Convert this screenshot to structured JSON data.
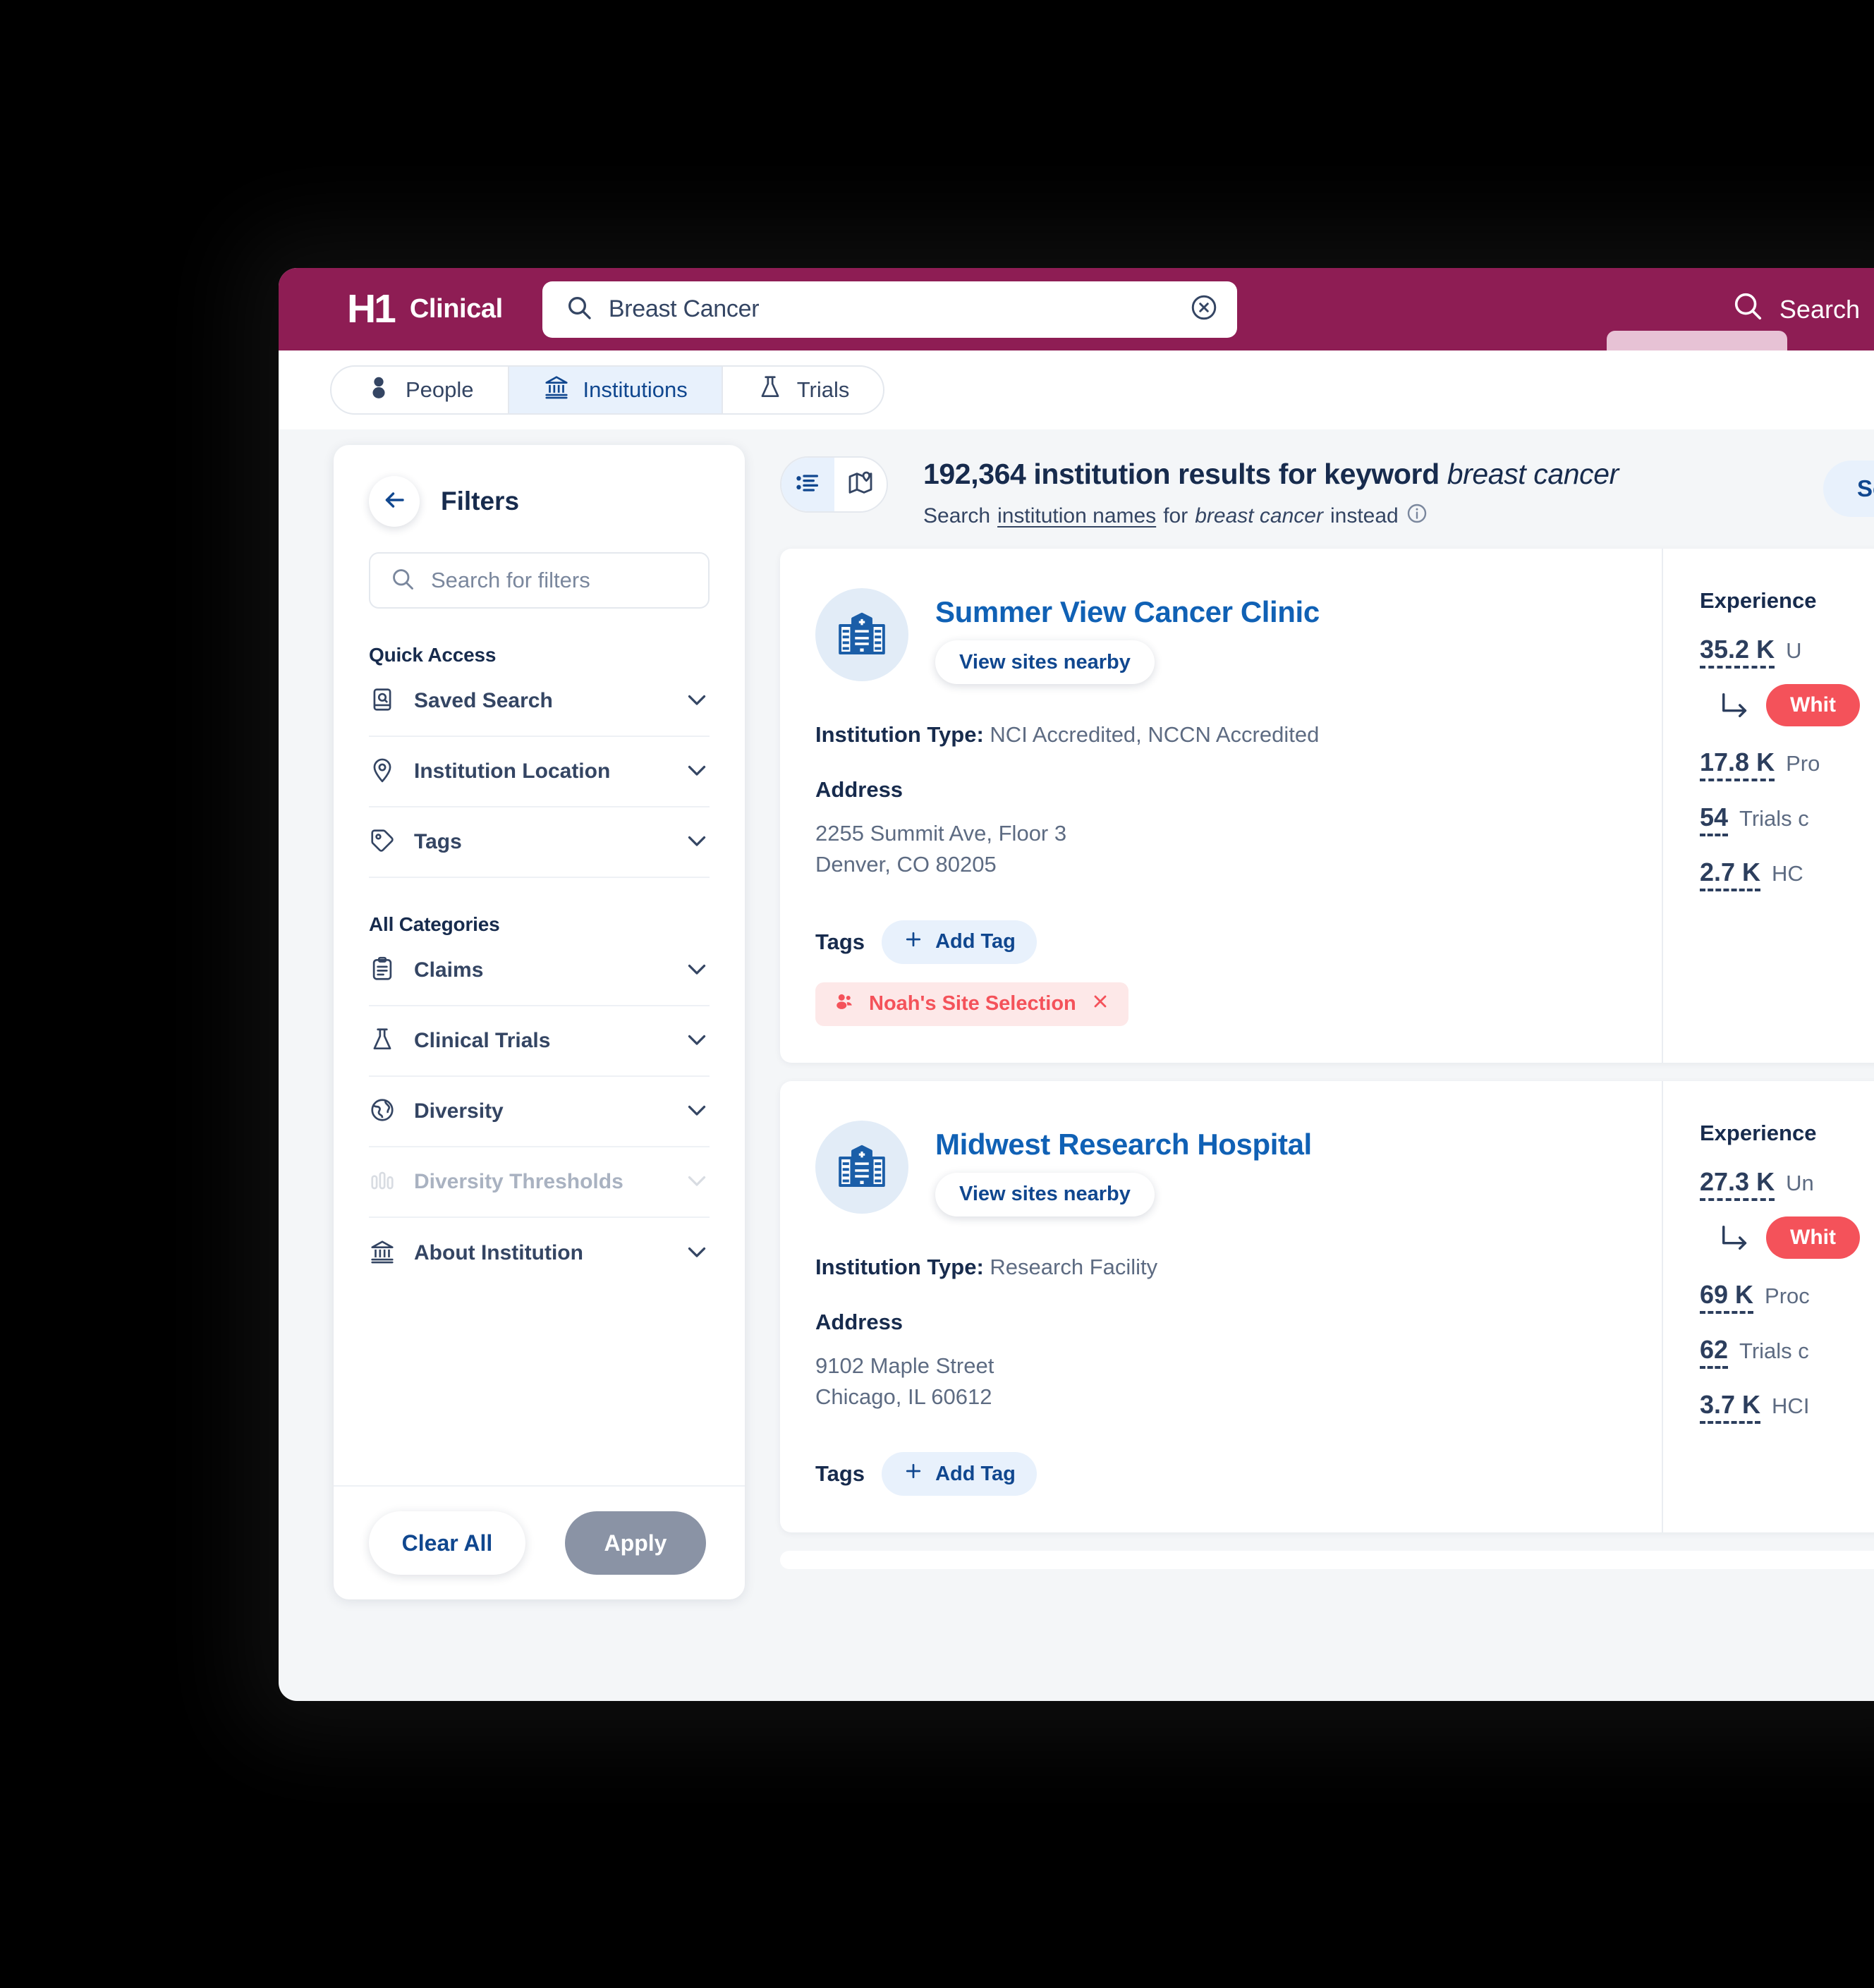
{
  "header": {
    "logo_mark": "H1",
    "logo_word": "Clinical",
    "search_value": "Breast Cancer",
    "search_icon": "search-icon",
    "clear_icon": "clear-circle-icon",
    "nav_search_label": "Search",
    "nav_search_icon": "search-icon",
    "nav_list_icon": "list-menu-icon",
    "brand_color": "#8e1d54"
  },
  "entity_tabs": [
    {
      "label": "People",
      "icon": "person-icon",
      "active": false
    },
    {
      "label": "Institutions",
      "icon": "institution-icon",
      "active": true
    },
    {
      "label": "Trials",
      "icon": "flask-icon",
      "active": false
    }
  ],
  "filters": {
    "title": "Filters",
    "back_icon": "arrow-left-icon",
    "search_placeholder": "Search for filters",
    "search_icon": "search-icon",
    "quick_access_label": "Quick Access",
    "quick_access": [
      {
        "label": "Saved Search",
        "icon": "saved-search-icon",
        "disabled": false
      },
      {
        "label": "Institution Location",
        "icon": "map-pin-icon",
        "disabled": false
      },
      {
        "label": "Tags",
        "icon": "tag-icon",
        "disabled": false
      }
    ],
    "all_categories_label": "All Categories",
    "all_categories": [
      {
        "label": "Claims",
        "icon": "clipboard-icon",
        "disabled": false
      },
      {
        "label": "Clinical Trials",
        "icon": "flask-icon",
        "disabled": false
      },
      {
        "label": "Diversity",
        "icon": "globe-icon",
        "disabled": false
      },
      {
        "label": "Diversity Thresholds",
        "icon": "bar-chart-icon",
        "disabled": true
      },
      {
        "label": "About Institution",
        "icon": "institution-icon",
        "disabled": false
      }
    ],
    "chevron_icon": "chevron-down-icon",
    "clear_all_label": "Clear All",
    "apply_label": "Apply"
  },
  "results_header": {
    "list_view_icon": "list-view-icon",
    "map_view_icon": "map-view-icon",
    "count": "192,364",
    "title_prefix": "192,364 institution results for keyword",
    "keyword": "breast cancer",
    "sub_prefix": "Search",
    "sub_link": "institution names",
    "sub_mid": "for",
    "sub_keyword": "breast cancer",
    "sub_suffix": "instead",
    "info_icon": "info-icon",
    "sort_label": "Sort"
  },
  "cards": [
    {
      "avatar_icon": "hospital-building-icon",
      "name": "Summer View Cancer Clinic",
      "nearby_label": "View sites nearby",
      "type_label": "Institution Type:",
      "type_value": "NCI Accredited, NCCN Accredited",
      "address_label": "Address",
      "address_line1": "2255 Summit Ave, Floor 3",
      "address_line2": "Denver, CO 80205",
      "tags_label": "Tags",
      "add_tag_label": "Add Tag",
      "add_tag_icon": "plus-icon",
      "tags": [
        {
          "label": "Noah's Site Selection",
          "icon": "people-icon",
          "remove_icon": "close-icon",
          "color": "#f4525a"
        }
      ],
      "experience_title": "Experience",
      "stats": [
        {
          "num": "35.2 K",
          "label": "U"
        },
        {
          "num": "17.8 K",
          "label": "Pro"
        },
        {
          "num": "54",
          "label": "Trials c"
        },
        {
          "num": "2.7 K",
          "label": "HC"
        }
      ],
      "sub_stat": {
        "elbow_icon": "elbow-arrow-icon",
        "pill": "Whit"
      }
    },
    {
      "avatar_icon": "hospital-building-icon",
      "name": "Midwest Research Hospital",
      "nearby_label": "View sites nearby",
      "type_label": "Institution Type:",
      "type_value": "Research Facility",
      "address_label": "Address",
      "address_line1": "9102 Maple Street",
      "address_line2": "Chicago, IL 60612",
      "tags_label": "Tags",
      "add_tag_label": "Add Tag",
      "add_tag_icon": "plus-icon",
      "tags": [],
      "experience_title": "Experience",
      "stats": [
        {
          "num": "27.3 K",
          "label": "Un"
        },
        {
          "num": "69 K",
          "label": "Proc"
        },
        {
          "num": "62",
          "label": "Trials c"
        },
        {
          "num": "3.7 K",
          "label": "HCI"
        }
      ],
      "sub_stat": {
        "elbow_icon": "elbow-arrow-icon",
        "pill": "Whit"
      }
    }
  ]
}
